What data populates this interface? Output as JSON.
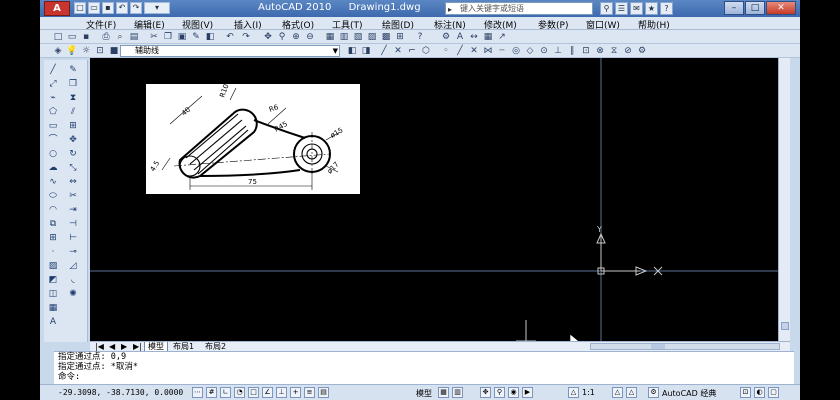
{
  "app": {
    "logo": "A",
    "title": "AutoCAD 2010",
    "file": "Drawing1.dwg",
    "search_placeholder": "键入关键字或短语"
  },
  "menu": [
    "文件(F)",
    "编辑(E)",
    "视图(V)",
    "插入(I)",
    "格式(O)",
    "工具(T)",
    "绘图(D)",
    "标注(N)",
    "修改(M)",
    "参数(P)",
    "窗口(W)",
    "帮助(H)"
  ],
  "layer": {
    "current": "辅助线"
  },
  "reference_drawing": {
    "dims": [
      "R10",
      "R6",
      "40",
      "R45",
      "ø15",
      "ø17",
      "4.5",
      "75"
    ]
  },
  "ucs": {
    "y_label": "Y",
    "x_label": "X"
  },
  "layout_tabs": [
    "模型",
    "布局1",
    "布局2"
  ],
  "command": {
    "lines": [
      "指定通过点: 0,9",
      "指定通过点: *取消*",
      "命令:"
    ]
  },
  "status": {
    "coords": "-29.3098,  -38.7130, 0.0000",
    "model_label": "模型",
    "scale": "1:1",
    "workspace": "AutoCAD 经典"
  },
  "colors": {
    "titlebar": "#3d6aae",
    "canvas": "#000000",
    "crosshair": "#5a6f94",
    "ucs": "#c8c8c8"
  }
}
